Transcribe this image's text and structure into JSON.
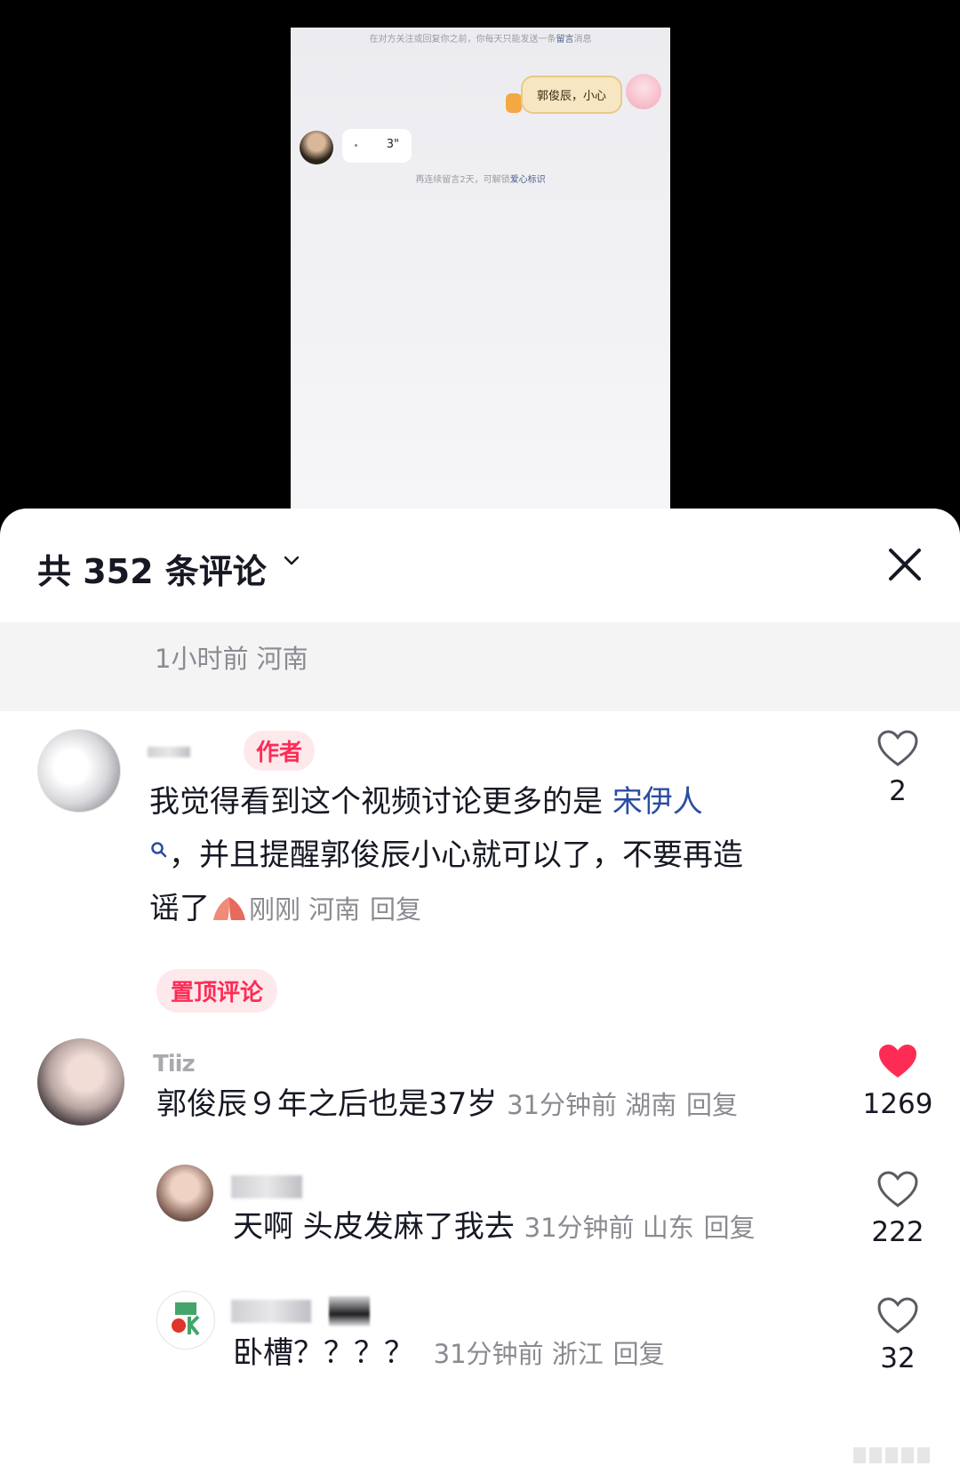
{
  "dm_preview": {
    "notice_prefix": "在对方关注或回复你之前，你每天只能发送一条",
    "notice_link": "留言",
    "notice_suffix": "消息",
    "sent_message": "郭俊辰，小心",
    "voice_length": "3\"",
    "hint_prefix": "再连续留言2天，可解锁",
    "hint_link": "爱心标识"
  },
  "panel": {
    "title": "共 352 条评论",
    "hidden_row_meta": "1小时前  河南"
  },
  "comments": [
    {
      "badge": "作者",
      "text_before": "我觉得看到这个视频讨论更多的是 ",
      "mention": "宋伊人",
      "text_after": "，并且提醒郭俊辰小心就可以了，不要再造谣了",
      "meta": "刚刚  河南",
      "reply": "回复",
      "pin": "置顶评论",
      "likes": "2"
    },
    {
      "name": "Tı̇ı̇z",
      "text": "郭俊辰９年之后也是37岁",
      "meta": "31分钟前  湖南",
      "reply": "回复",
      "likes": "1269"
    },
    {
      "text": "天啊 头皮发麻了我去",
      "meta": "31分钟前  山东",
      "reply": "回复",
      "likes": "222"
    },
    {
      "text": "卧槽？？？？",
      "meta": "31分钟前  浙江",
      "reply": "回复",
      "likes": "32"
    }
  ],
  "colors": {
    "accent_red": "#fe2c55",
    "mention_blue": "#2b4da2",
    "meta_gray": "#8a8b91"
  }
}
